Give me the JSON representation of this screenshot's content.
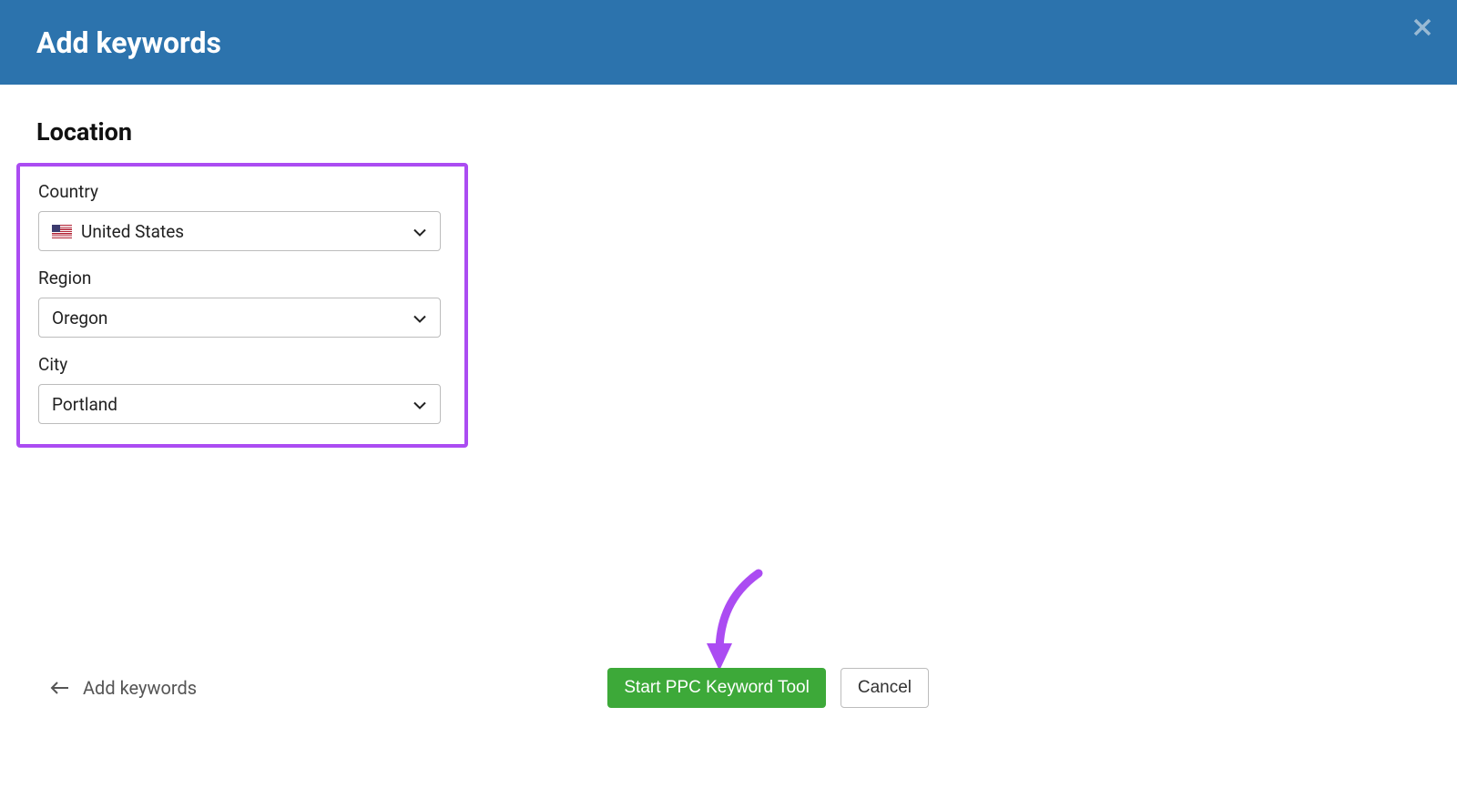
{
  "header": {
    "title": "Add keywords"
  },
  "location": {
    "section_title": "Location",
    "country_label": "Country",
    "country_value": "United States",
    "region_label": "Region",
    "region_value": "Oregon",
    "city_label": "City",
    "city_value": "Portland"
  },
  "footer": {
    "back_label": "Add keywords",
    "primary_label": "Start PPC Keyword Tool",
    "cancel_label": "Cancel"
  }
}
